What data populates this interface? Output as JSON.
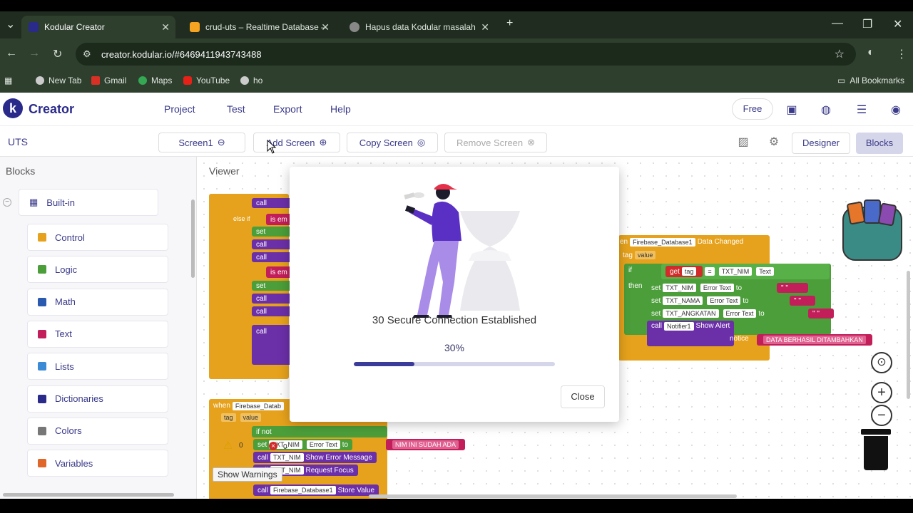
{
  "browser": {
    "tabs": [
      {
        "title": "Kodular Creator",
        "active": true
      },
      {
        "title": "crud-uts – Realtime Database –",
        "active": false
      },
      {
        "title": "Hapus data Kodular masalah",
        "active": false
      }
    ],
    "url": "creator.kodular.io/#6469411943743488",
    "bookmarks": [
      "New Tab",
      "Gmail",
      "Maps",
      "YouTube",
      "ho"
    ],
    "all_bookmarks": "All Bookmarks"
  },
  "app": {
    "brand": "Creator",
    "menu": [
      "Project",
      "Test",
      "Export",
      "Help"
    ],
    "plan": "Free",
    "project_name": "UTS",
    "screen_select": "Screen1",
    "add_screen": "Add Screen",
    "copy_screen": "Copy Screen",
    "remove_screen": "Remove Screen",
    "designer": "Designer",
    "blocks": "Blocks"
  },
  "palette": {
    "title": "Blocks",
    "builtin": "Built-in",
    "items": [
      {
        "label": "Control",
        "color": "#e6a21c"
      },
      {
        "label": "Logic",
        "color": "#4c9e3a"
      },
      {
        "label": "Math",
        "color": "#2a5ab0"
      },
      {
        "label": "Text",
        "color": "#c21f5a"
      },
      {
        "label": "Lists",
        "color": "#3a8ad6"
      },
      {
        "label": "Dictionaries",
        "color": "#2a2a8a"
      },
      {
        "label": "Colors",
        "color": "#777777"
      },
      {
        "label": "Variables",
        "color": "#e0662a"
      }
    ]
  },
  "viewer": {
    "title": "Viewer",
    "show_warnings": "Show Warnings",
    "warn_count": "0",
    "err_count": "0",
    "event1": {
      "component": "Firebase_Database1",
      "event": "Data Changed",
      "params": [
        "tag",
        "value"
      ]
    },
    "blocks_right": {
      "get_tag": "tag",
      "op": "=",
      "txt_nim": "TXT_NIM",
      "text_prop": "Text",
      "set1": "TXT_NIM",
      "set2": "TXT_NAMA",
      "set3": "TXT_ANGKATAN",
      "error_text": "Error Text",
      "notifier": "Notifier1",
      "show_alert": "Show Alert",
      "notice": "notice",
      "message": "DATA BERHASIL DITAMBAHKAN"
    },
    "event2": {
      "component": "Firebase_Datab",
      "params": [
        "tag",
        "value"
      ]
    },
    "blocks_bottom": {
      "set_nim": "TXT_NIM",
      "error_text": "Error Text",
      "msg": "NIM INI SUDAH ADA",
      "call_nim": "TXT_NIM",
      "show_error": "Show Error Message",
      "request_focus": "Request Focus",
      "store_component": "Firebase_Database1",
      "store_value": "Store Value"
    }
  },
  "modal": {
    "status": "30 Secure Connection Established",
    "percent_label": "30%",
    "progress": 0.3,
    "close": "Close"
  }
}
